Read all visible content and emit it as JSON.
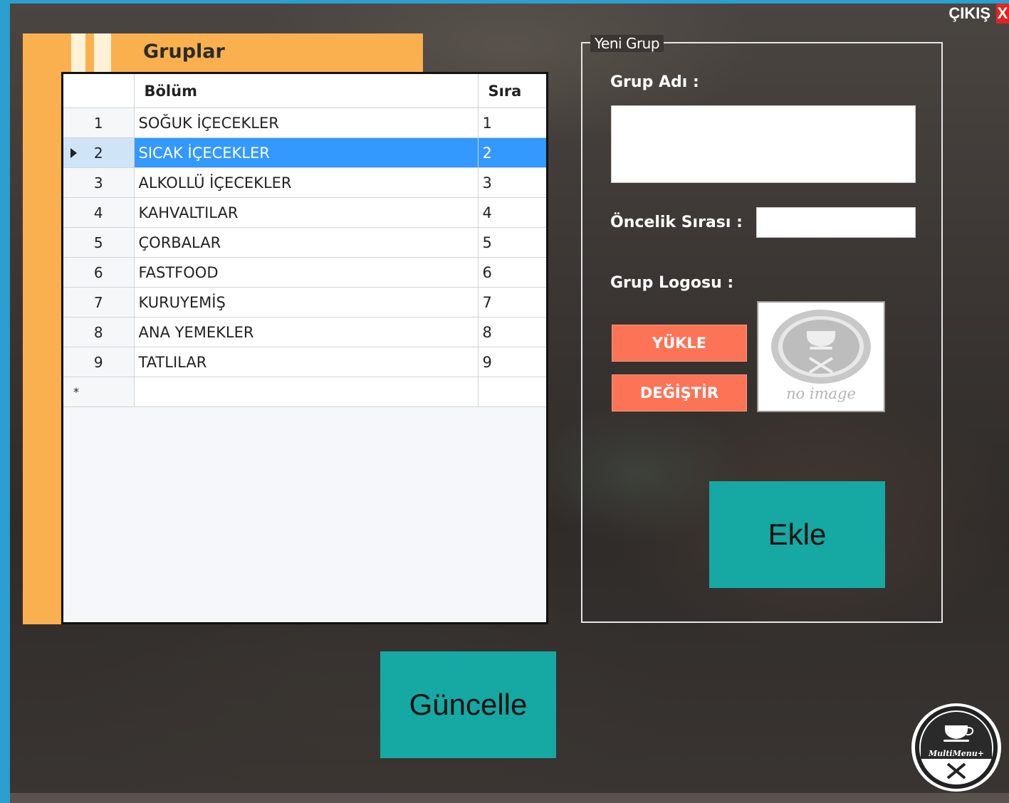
{
  "window": {
    "exit_label": "ÇIKIŞ",
    "exit_icon_glyph": "X"
  },
  "groups_panel": {
    "title": "Gruplar",
    "columns": [
      "Bölüm",
      "Sıra"
    ],
    "rows": [
      {
        "row_num": "1",
        "name": "SOĞUK İÇECEKLER",
        "order": "1"
      },
      {
        "row_num": "2",
        "name": "SICAK İÇECEKLER",
        "order": "2"
      },
      {
        "row_num": "3",
        "name": "ALKOLLÜ İÇECEKLER",
        "order": "3"
      },
      {
        "row_num": "4",
        "name": "KAHVALTILAR",
        "order": "4"
      },
      {
        "row_num": "5",
        "name": "ÇORBALAR",
        "order": "5"
      },
      {
        "row_num": "6",
        "name": "FASTFOOD",
        "order": "6"
      },
      {
        "row_num": "7",
        "name": "KURUYEMİŞ",
        "order": "7"
      },
      {
        "row_num": "8",
        "name": "ANA YEMEKLER",
        "order": "8"
      },
      {
        "row_num": "9",
        "name": "TATLILAR",
        "order": "9"
      }
    ],
    "selected_row": 2,
    "new_row_marker": "*"
  },
  "new_group": {
    "title": "Yeni Grup",
    "name_label": "Grup Adı :",
    "name_value": "",
    "priority_label": "Öncelik Sırası :",
    "priority_value": "",
    "logo_label": "Grup Logosu :",
    "upload_button": "YÜKLE",
    "change_button": "DEĞİŞTİR",
    "no_image_text": "no image",
    "add_button": "Ekle"
  },
  "update_button": "Güncelle",
  "brand": {
    "logo_text": "MultiMenu+"
  },
  "colors": {
    "orange": "#fbb04f",
    "coral": "#fd7356",
    "teal": "#16a8a2",
    "selection": "#3399ff",
    "exit_red": "#e4241f"
  }
}
